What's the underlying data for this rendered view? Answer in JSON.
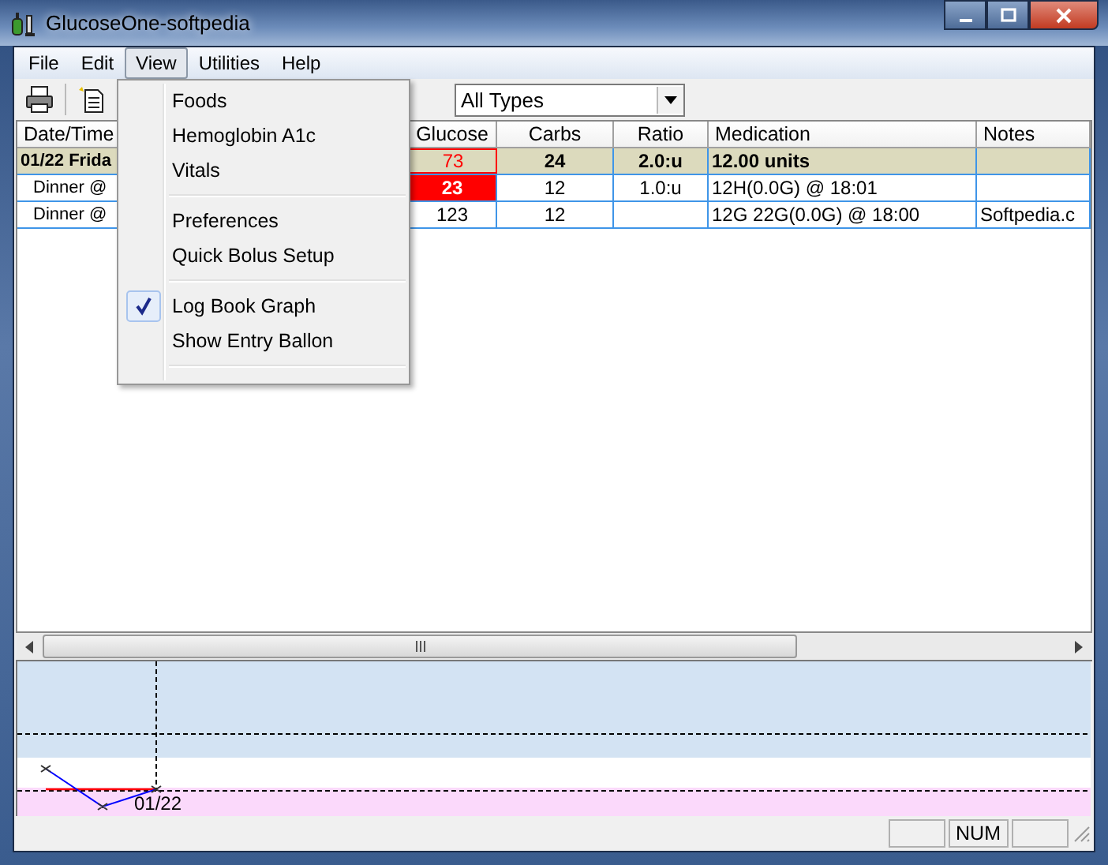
{
  "window": {
    "title": "GlucoseOne-softpedia"
  },
  "menu_bar": [
    {
      "label": "File",
      "selected": false
    },
    {
      "label": "Edit",
      "selected": false
    },
    {
      "label": "View",
      "selected": true
    },
    {
      "label": "Utilities",
      "selected": false
    },
    {
      "label": "Help",
      "selected": false
    }
  ],
  "view_menu": [
    {
      "kind": "item",
      "label": "Foods",
      "checked": false
    },
    {
      "kind": "item",
      "label": "Hemoglobin A1c",
      "checked": false
    },
    {
      "kind": "item",
      "label": "Vitals",
      "checked": false
    },
    {
      "kind": "separator"
    },
    {
      "kind": "item",
      "label": "Preferences",
      "checked": false
    },
    {
      "kind": "item",
      "label": "Quick Bolus Setup",
      "checked": false
    },
    {
      "kind": "separator"
    },
    {
      "kind": "item",
      "label": "Log Book Graph",
      "checked": true
    },
    {
      "kind": "item",
      "label": "Show Entry Ballon",
      "checked": false
    },
    {
      "kind": "separator"
    }
  ],
  "toolbar": {
    "filter": {
      "value": "All Types"
    }
  },
  "table": {
    "columns": [
      "Date/Time",
      "Glucose",
      "Carbs",
      "Ratio",
      "Medication",
      "Notes"
    ],
    "rows": [
      {
        "kind": "day",
        "glucose_outlined": true,
        "glucose_highlighted": false,
        "cells": [
          "01/22 Frida",
          "73",
          "24",
          "2.0:u",
          "12.00 units",
          ""
        ]
      },
      {
        "kind": "entry",
        "glucose_outlined": false,
        "glucose_highlighted": true,
        "cells": [
          "Dinner @",
          "23",
          "12",
          "1.0:u",
          "12H(0.0G) @ 18:01",
          ""
        ]
      },
      {
        "kind": "entry",
        "glucose_outlined": false,
        "glucose_highlighted": false,
        "cells": [
          "Dinner @",
          "123",
          "12",
          "",
          "12G 22G(0.0G) @ 18:00",
          "Softpedia.c"
        ]
      }
    ]
  },
  "graph": {
    "date_label": "01/22"
  },
  "status_bar": {
    "indicator": "NUM"
  }
}
